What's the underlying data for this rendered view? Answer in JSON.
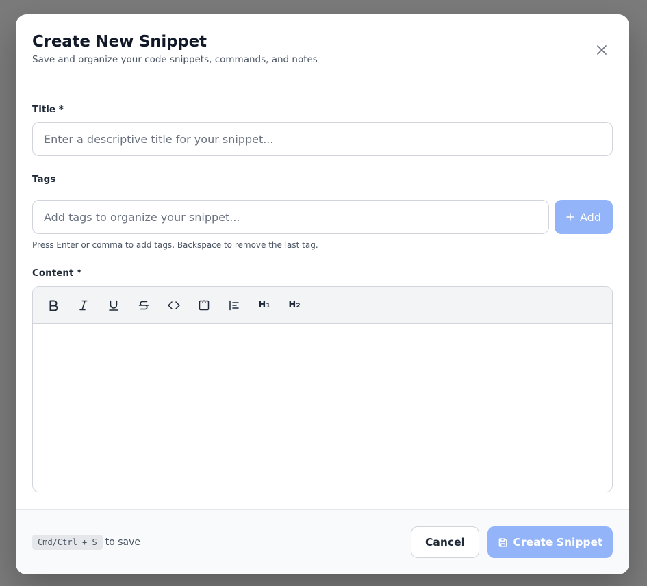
{
  "modal": {
    "title": "Create New Snippet",
    "subtitle": "Save and organize your code snippets, commands, and notes"
  },
  "form": {
    "title_label": "Title *",
    "title_placeholder": "Enter a descriptive title for your snippet...",
    "title_value": "",
    "tags_label": "Tags",
    "tags_placeholder": "Add tags to organize your snippet...",
    "tags_value": "",
    "add_button_label": "Add",
    "tags_help": "Press Enter or comma to add tags. Backspace to remove the last tag.",
    "content_label": "Content *",
    "content_value": ""
  },
  "toolbar": {
    "items": [
      {
        "name": "bold-icon",
        "label": "B"
      },
      {
        "name": "italic-icon",
        "label": "I"
      },
      {
        "name": "underline-icon",
        "label": "U"
      },
      {
        "name": "strikethrough-icon",
        "label": "S"
      },
      {
        "name": "code-icon",
        "label": "<>"
      },
      {
        "name": "code-block-icon",
        "label": ""
      },
      {
        "name": "align-list-icon",
        "label": ""
      },
      {
        "name": "heading-1-icon",
        "label": "H1"
      },
      {
        "name": "heading-2-icon",
        "label": "H2"
      }
    ]
  },
  "footer": {
    "shortcut": "Cmd/Ctrl + S",
    "shortcut_hint": "to save",
    "cancel_label": "Cancel",
    "create_label": "Create Snippet"
  },
  "colors": {
    "primary_disabled": "#93b4f8",
    "overlay": "#7b7b7b",
    "text_primary": "#111827"
  }
}
